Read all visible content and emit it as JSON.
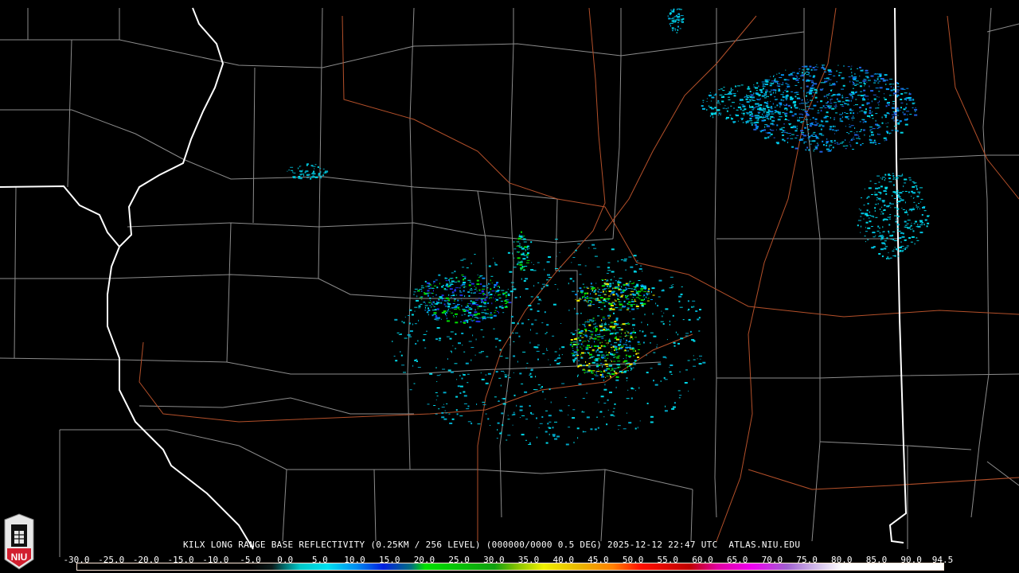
{
  "product": {
    "title": "KILX LONG RANGE BASE REFLECTIVITY (0.25KM / 256 LEVEL) (000000/0000 0.5 DEG) 2025-12-12 22:47 UTC  ATLAS.NIU.EDU"
  },
  "logo": {
    "text": "NIU"
  },
  "colorbar": {
    "labels": [
      "-30.0",
      "-25.0",
      "-20.0",
      "-15.0",
      "-10.0",
      "-5.0",
      "0.0",
      "5.0",
      "10.0",
      "15.0",
      "20.0",
      "25.0",
      "30.0",
      "35.0",
      "40.0",
      "45.0",
      "50.0",
      "55.0",
      "60.0",
      "65.0",
      "70.0",
      "75.0",
      "80.0",
      "85.0",
      "90.0",
      "94.5"
    ],
    "values": [
      -30,
      -25,
      -20,
      -15,
      -10,
      -5,
      0,
      5,
      10,
      15,
      20,
      25,
      30,
      35,
      40,
      45,
      50,
      55,
      60,
      65,
      70,
      75,
      80,
      85,
      90,
      94.5
    ],
    "stops": [
      {
        "dbz": -30,
        "color": "#000000"
      },
      {
        "dbz": -5,
        "color": "#000000"
      },
      {
        "dbz": -2,
        "color": "#0a1a1a"
      },
      {
        "dbz": 0,
        "color": "#007878"
      },
      {
        "dbz": 2,
        "color": "#00c8c8"
      },
      {
        "dbz": 6,
        "color": "#00e0f0"
      },
      {
        "dbz": 10,
        "color": "#0090f0"
      },
      {
        "dbz": 14,
        "color": "#0020e0"
      },
      {
        "dbz": 18,
        "color": "#007080"
      },
      {
        "dbz": 20,
        "color": "#00e000"
      },
      {
        "dbz": 30,
        "color": "#10a010"
      },
      {
        "dbz": 33,
        "color": "#80c000"
      },
      {
        "dbz": 37,
        "color": "#f0f000"
      },
      {
        "dbz": 42,
        "color": "#e8b800"
      },
      {
        "dbz": 47,
        "color": "#ff8000"
      },
      {
        "dbz": 51,
        "color": "#ff1000"
      },
      {
        "dbz": 58,
        "color": "#c00000"
      },
      {
        "dbz": 62,
        "color": "#e000a0"
      },
      {
        "dbz": 67,
        "color": "#f000f0"
      },
      {
        "dbz": 72,
        "color": "#a060d0"
      },
      {
        "dbz": 76,
        "color": "#d0b8e8"
      },
      {
        "dbz": 80,
        "color": "#ffffff"
      },
      {
        "dbz": 94.5,
        "color": "#ffffff"
      }
    ]
  },
  "colors": {
    "state_border": "#ffffff",
    "county": "#8c8c8c",
    "highway": "#b4502a"
  }
}
